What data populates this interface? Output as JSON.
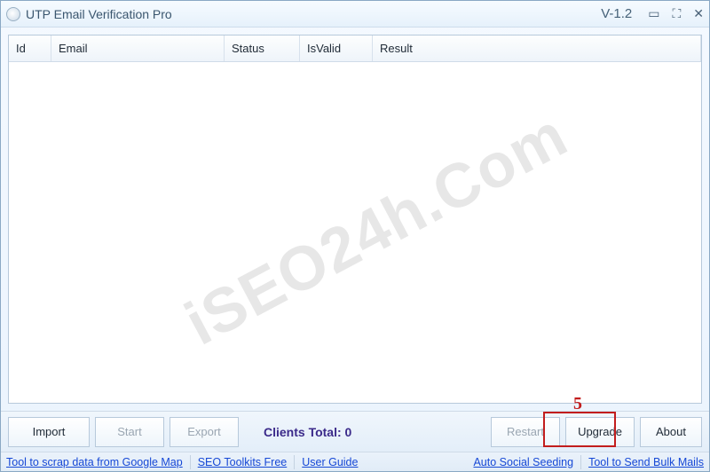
{
  "titlebar": {
    "title": "UTP Email Verification Pro",
    "version": "V-1.2"
  },
  "grid": {
    "columns": {
      "id": "Id",
      "email": "Email",
      "status": "Status",
      "isvalid": "IsValid",
      "result": "Result"
    }
  },
  "watermark": "iSEO24h.Com",
  "annotation": {
    "label": "5"
  },
  "toolbar": {
    "import": "Import",
    "start": "Start",
    "export": "Export",
    "clients_total_label": "Clients Total: 0",
    "restart": "Restart",
    "upgrade": "Upgrade",
    "about": "About"
  },
  "footer": {
    "scrap": "Tool to scrap data from Google Map",
    "seo": "SEO Toolkits Free",
    "guide": "User Guide",
    "social": "Auto Social Seeding",
    "bulk": "Tool to Send Bulk Mails"
  }
}
